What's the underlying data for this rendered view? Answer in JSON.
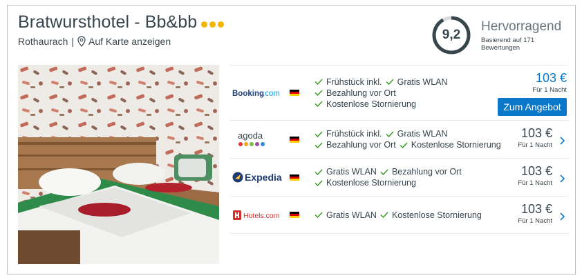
{
  "hotel": {
    "name": "Bratwursthotel - Bb&bb",
    "stars": 3,
    "location": "Rothaurach",
    "separator": "|",
    "map_link": "Auf Karte anzeigen"
  },
  "rating": {
    "score": "9,2",
    "score_fraction": 0.92,
    "label": "Hervorragend",
    "based_on": "Basierend auf 171 Bewertungen"
  },
  "colors": {
    "accent_blue": "#0a77c9",
    "star_yellow": "#f4b400",
    "check_green": "#3a9a24",
    "text": "#37454d"
  },
  "offers": [
    {
      "provider": "Booking.com",
      "provider_icon": "booking-logo",
      "features": [
        [
          "Frühstück inkl.",
          "Gratis WLAN"
        ],
        [
          "Bezahlung vor Ort"
        ],
        [
          "Kostenlose Stornierung"
        ]
      ],
      "price": "103 €",
      "per_night": "Für 1 Nacht",
      "button": "Zum Angebot",
      "highlighted": true
    },
    {
      "provider": "agoda",
      "provider_icon": "agoda-logo",
      "features": [
        [
          "Frühstück inkl.",
          "Gratis WLAN"
        ],
        [
          "Bezahlung vor Ort",
          "Kostenlose Stornierung"
        ]
      ],
      "price": "103 €",
      "per_night": "Für 1 Nacht"
    },
    {
      "provider": "Expedia",
      "provider_icon": "expedia-logo",
      "features": [
        [
          "Gratis WLAN",
          "Bezahlung vor Ort"
        ],
        [
          "Kostenlose Stornierung"
        ]
      ],
      "price": "103 €",
      "per_night": "Für 1 Nacht"
    },
    {
      "provider": "Hotels.com",
      "provider_icon": "hotels-com-logo",
      "features": [
        [
          "Gratis WLAN",
          "Kostenlose Stornierung"
        ]
      ],
      "price": "103 €",
      "per_night": "Für 1 Nacht"
    }
  ]
}
